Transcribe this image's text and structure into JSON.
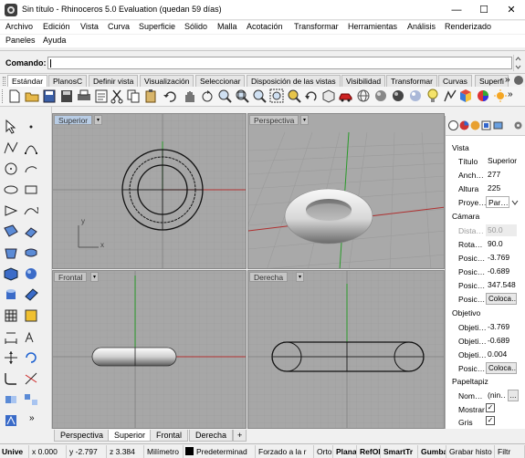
{
  "window": {
    "title": "Sin título - Rhinoceros 5.0 Evaluation (quedan 59 días)",
    "minimize": "—",
    "maximize": "☐",
    "close": "✕"
  },
  "menu": {
    "row1": [
      "Archivo",
      "Edición",
      "Vista",
      "Curva",
      "Superficie",
      "Sólido",
      "Malla",
      "Acotación",
      "Transformar",
      "Herramientas",
      "Análisis",
      "Renderizado"
    ],
    "row2": [
      "Paneles",
      "Ayuda"
    ]
  },
  "command": {
    "label": "Comando:",
    "value": ""
  },
  "toolbar_tabs": [
    "Estándar",
    "PlanosC",
    "Definir vista",
    "Visualización",
    "Seleccionar",
    "Disposición de las vistas",
    "Visibilidad",
    "Transformar",
    "Curvas",
    "Superfi"
  ],
  "toolbar_tabs_more": "»",
  "viewports": {
    "top": {
      "label": "Superior",
      "x_axis": "x",
      "y_axis": "y"
    },
    "perspective": {
      "label": "Perspectiva"
    },
    "front": {
      "label": "Frontal"
    },
    "right": {
      "label": "Derecha"
    },
    "menu_arrow": "▾"
  },
  "view_tabs": [
    "Perspectiva",
    "Superior",
    "Frontal",
    "Derecha"
  ],
  "view_tabs_add": "+",
  "right_panel": {
    "vista": {
      "heading": "Vista",
      "rows": [
        {
          "label": "Título",
          "value": "Superior"
        },
        {
          "label": "Anch…",
          "value": "277"
        },
        {
          "label": "Altura",
          "value": "225"
        },
        {
          "label": "Proye…",
          "value": "Par…"
        }
      ]
    },
    "camara": {
      "heading": "Cámara",
      "rows": [
        {
          "label": "Dista…",
          "value": "50.0"
        },
        {
          "label": "Rota…",
          "value": "90.0"
        },
        {
          "label": "Posic…",
          "value": "-3.769"
        },
        {
          "label": "Posic…",
          "value": "-0.689"
        },
        {
          "label": "Posic…",
          "value": "347.548"
        },
        {
          "label": "Posic…",
          "value": "Coloca…"
        }
      ]
    },
    "objetivo": {
      "heading": "Objetivo",
      "rows": [
        {
          "label": "Objeti…",
          "value": "-3.769"
        },
        {
          "label": "Objeti…",
          "value": "-0.689"
        },
        {
          "label": "Objeti…",
          "value": "0.004"
        },
        {
          "label": "Posic…",
          "value": "Coloca…"
        }
      ]
    },
    "papeltapiz": {
      "heading": "Papeltapiz",
      "rows": [
        {
          "label": "Nom…",
          "value": "(nin…",
          "extra": "…"
        },
        {
          "label": "Mostrar",
          "checked": "✓"
        },
        {
          "label": "Gris",
          "checked": "✓"
        }
      ]
    }
  },
  "status": [
    "Unive",
    "x 0.000",
    "y -2.797",
    "z 3.384",
    "Milímetro",
    "Predeterminad",
    "Forzado a la r",
    "Orto",
    "Plana",
    "RefOb",
    "SmartTr",
    "Gumba",
    "Grabar histo",
    "Filtr"
  ],
  "colors": {
    "viewport_bg": "#a7a7a7",
    "grid_line": "#9b9b9b",
    "axis_x": "#b03030",
    "axis_y": "#2a9a2a",
    "active_tab": "#b8cce4"
  }
}
